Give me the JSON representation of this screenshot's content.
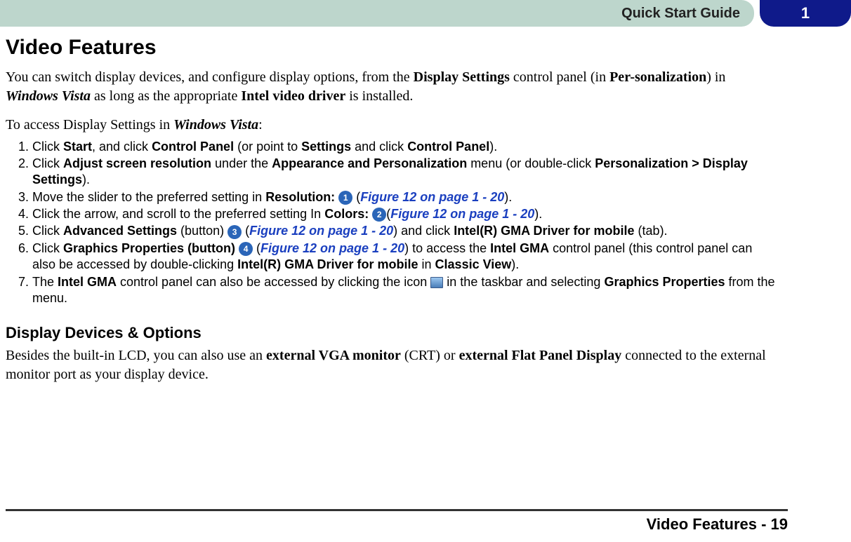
{
  "header": {
    "title": "Quick Start Guide",
    "chapter": "1"
  },
  "h1": "Video Features",
  "intro": {
    "t1": "You can switch display devices, and configure display options, from the ",
    "b1": "Display Settings",
    "t2": " control panel (in ",
    "b2": "Per-sonalization",
    "t3": ") in ",
    "i1": "Windows Vista",
    "t4": " as long as the appropriate ",
    "b3": "Intel video driver",
    "t5": " is installed."
  },
  "access": {
    "t1": "To access Display Settings in ",
    "i1": "Windows Vista",
    "t2": ":"
  },
  "steps": {
    "s1": {
      "a": "Click ",
      "b": "Start",
      "c": ", and click ",
      "d": "Control Panel",
      "e": " (or point to ",
      "f": "Settings",
      "g": " and click ",
      "h": "Control Panel",
      "i": ")."
    },
    "s2": {
      "a": "Click ",
      "b": "Adjust screen resolution",
      "c": " under the ",
      "d": "Appearance and Personalization",
      "e": " menu (or double-click ",
      "f": "Personalization > Display Settings",
      "g": ")."
    },
    "s3": {
      "a": "Move the slider to the preferred setting in ",
      "b": "Resolution: ",
      "n": "1",
      "c": " (",
      "fig": "Figure 12 on page 1 - 20",
      "d": ")."
    },
    "s4": {
      "a": "Click the arrow, and scroll to the preferred setting In ",
      "b": "Colors: ",
      "n": "2",
      "c": "(",
      "fig": "Figure 12 on page 1 - 20",
      "d": ")."
    },
    "s5": {
      "a": "Click ",
      "b": "Advanced Settings",
      "c": " (button) ",
      "n": "3",
      "d": " (",
      "fig": "Figure 12 on page 1 - 20",
      "e": ") and click ",
      "f": "Intel(R) GMA Driver for mobile",
      "g": " (tab)."
    },
    "s6": {
      "a": "Click ",
      "b": "Graphics Properties (button) ",
      "n": "4",
      "c": " (",
      "fig": "Figure 12 on page 1 - 20",
      "d": ") to access the ",
      "e": "Intel GMA",
      "f": " control panel (this control panel can also be accessed by double-clicking ",
      "g": "Intel(R) GMA Driver for mobile",
      "h": " in ",
      "i": "Classic View",
      "j": ")."
    },
    "s7": {
      "a": "The ",
      "b": "Intel GMA",
      "c": " control panel can also be accessed by clicking the icon ",
      "d": " in the taskbar and selecting ",
      "e": "Graphics Properties",
      "f": " from the menu."
    }
  },
  "h2": "Display Devices & Options",
  "ddpara": {
    "t1": "Besides the built-in LCD, you can also use an ",
    "b1": "external VGA monitor",
    "t2": " (CRT) or ",
    "b2": "external Flat Panel Display",
    "t3": " connected to the external monitor port as your display device."
  },
  "footer": "Video Features - 19"
}
